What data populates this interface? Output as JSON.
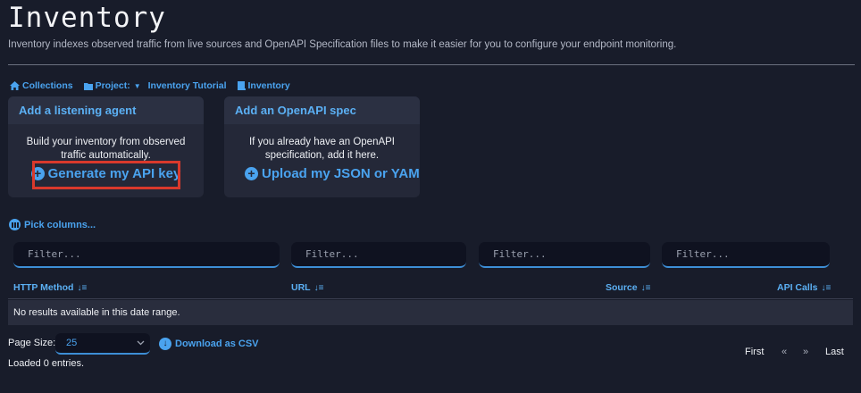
{
  "header": {
    "title": "Inventory",
    "subtitle": "Inventory indexes observed traffic from live sources and OpenAPI Specification files to make it easier for you to configure your endpoint monitoring."
  },
  "breadcrumbs": {
    "collections": "Collections",
    "project_label": "Project:",
    "project_name": "Inventory Tutorial",
    "inventory": "Inventory"
  },
  "cards": {
    "agent": {
      "title": "Add a listening agent",
      "text_line1": "Build your inventory from observed",
      "text_line2": "traffic automatically.",
      "action": "Generate my API key"
    },
    "openapi": {
      "title": "Add an OpenAPI spec",
      "text_line1": "If you already have an OpenAPI",
      "text_line2": "specification, add it here.",
      "action": "Upload my JSON or YAML file"
    }
  },
  "table": {
    "pick_columns": "Pick columns...",
    "filter_placeholder": "Filter...",
    "columns": [
      "HTTP Method",
      "URL",
      "Source",
      "API Calls"
    ],
    "empty_message": "No results available in this date range."
  },
  "footer": {
    "page_size_label": "Page Size:",
    "page_size_value": "25",
    "download_csv": "Download as CSV",
    "loaded": "Loaded 0 entries.",
    "first": "First",
    "prev": "«",
    "next": "»",
    "last": "Last"
  },
  "colors": {
    "background": "#181c2a",
    "accent": "#4aa3ef",
    "highlight_box": "#d9392c"
  }
}
